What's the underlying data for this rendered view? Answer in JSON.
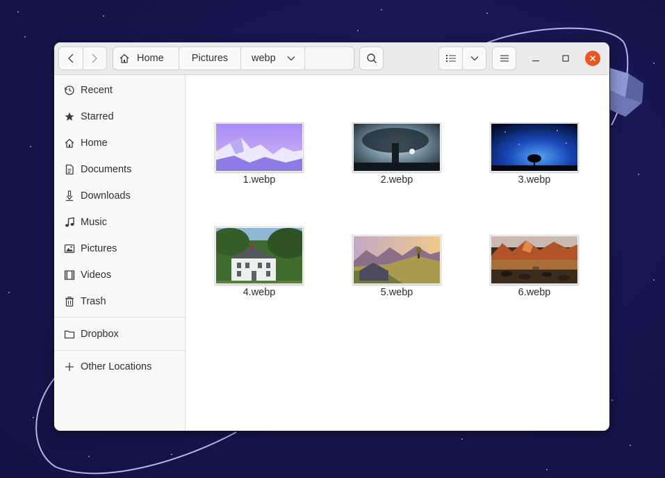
{
  "toolbar": {
    "back_icon": "chevron-left-icon",
    "forward_icon": "chevron-right-icon",
    "path": [
      {
        "label": "Home",
        "icon": "home-icon"
      },
      {
        "label": "Pictures"
      },
      {
        "label": "webp"
      }
    ],
    "search_icon": "search-icon",
    "view_icon": "list-view-icon",
    "menu_icon": "hamburger-menu-icon"
  },
  "window_controls": {
    "minimize_icon": "minimize-icon",
    "maximize_icon": "maximize-icon",
    "close_icon": "close-icon",
    "close_color": "#e95420"
  },
  "sidebar": {
    "items": [
      {
        "label": "Recent",
        "icon": "clock-icon"
      },
      {
        "label": "Starred",
        "icon": "star-icon"
      },
      {
        "label": "Home",
        "icon": "home-icon"
      },
      {
        "label": "Documents",
        "icon": "document-icon"
      },
      {
        "label": "Downloads",
        "icon": "download-icon"
      },
      {
        "label": "Music",
        "icon": "music-note-icon"
      },
      {
        "label": "Pictures",
        "icon": "image-icon"
      },
      {
        "label": "Videos",
        "icon": "film-icon"
      },
      {
        "label": "Trash",
        "icon": "trash-icon"
      }
    ],
    "places": [
      {
        "label": "Dropbox",
        "icon": "folder-icon"
      },
      {
        "label": "Other Locations",
        "icon": "plus-icon"
      }
    ]
  },
  "files": [
    {
      "name": "1.webp"
    },
    {
      "name": "2.webp"
    },
    {
      "name": "3.webp"
    },
    {
      "name": "4.webp"
    },
    {
      "name": "5.webp"
    },
    {
      "name": "6.webp"
    }
  ]
}
